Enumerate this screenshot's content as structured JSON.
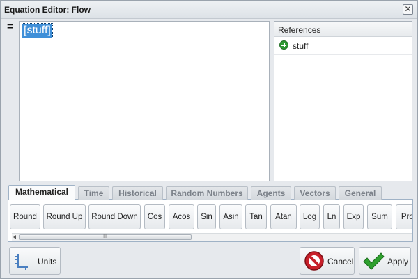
{
  "window": {
    "title": "Equation Editor: Flow",
    "close_glyph": "✕"
  },
  "editor": {
    "equals_sign": "=",
    "token": "[stuff]"
  },
  "references": {
    "header": "References",
    "items": [
      {
        "label": "stuff",
        "icon": "add-circle-icon",
        "icon_color": "#2f9a34"
      }
    ]
  },
  "tabs": [
    {
      "label": "Mathematical",
      "active": true
    },
    {
      "label": "Time",
      "active": false
    },
    {
      "label": "Historical",
      "active": false
    },
    {
      "label": "Random Numbers",
      "active": false
    },
    {
      "label": "Agents",
      "active": false
    },
    {
      "label": "Vectors",
      "active": false
    },
    {
      "label": "General",
      "active": false
    }
  ],
  "functions": [
    {
      "label": "Round"
    },
    {
      "label": "Round Up"
    },
    {
      "label": "Round Down"
    },
    {
      "label": "Cos"
    },
    {
      "label": "Acos"
    },
    {
      "label": "Sin"
    },
    {
      "label": "Asin"
    },
    {
      "label": "Tan"
    },
    {
      "label": "Atan"
    },
    {
      "label": "Log"
    },
    {
      "label": "Ln"
    },
    {
      "label": "Exp"
    },
    {
      "label": "Sum"
    },
    {
      "label": "Prod"
    }
  ],
  "scrollbar": {
    "thumb_grip": "III"
  },
  "buttons": {
    "units": "Units",
    "cancel": "Cancel",
    "apply": "Apply"
  },
  "colors": {
    "selection": "#3f8fd8",
    "apply_check": "#2ea02e",
    "cancel_red": "#c8202a"
  }
}
